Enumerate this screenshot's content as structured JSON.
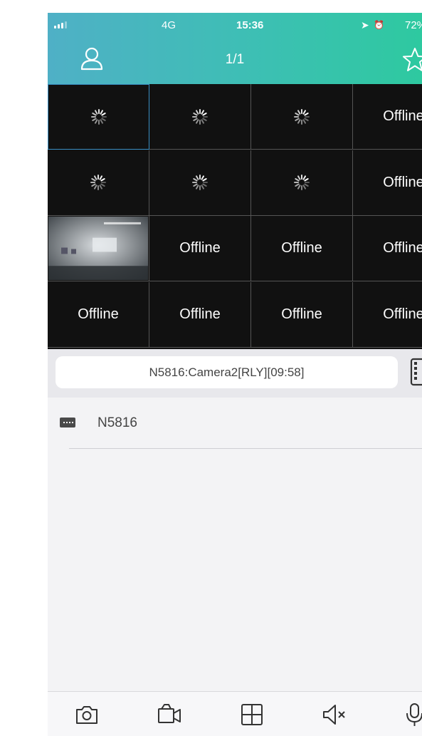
{
  "status_bar": {
    "network": "4G",
    "time": "15:36",
    "battery": "72%"
  },
  "header": {
    "page_indicator": "1/1",
    "icons": [
      "user-icon",
      "star-icon"
    ]
  },
  "grid": {
    "rows": [
      [
        "loading",
        "loading",
        "loading",
        "Offline"
      ],
      [
        "loading",
        "loading",
        "loading",
        "Offline"
      ],
      [
        "video",
        "Offline",
        "Offline",
        "Offline"
      ],
      [
        "Offline",
        "Offline",
        "Offline",
        "Offline"
      ]
    ],
    "selected_cell": [
      0,
      0
    ]
  },
  "channel_bar": {
    "current_channel": "N5816:Camera2[RLY][09:58]",
    "icon": "film-icon"
  },
  "device_list": {
    "devices": [
      {
        "name": "N5816",
        "icon": "nvr-icon"
      }
    ]
  },
  "toolbar": {
    "buttons": [
      "camera-icon",
      "video-record-icon",
      "grid-layout-icon",
      "speaker-mute-icon",
      "microphone-icon"
    ]
  },
  "colors": {
    "header_gradient_start": "#4fb0c6",
    "header_gradient_end": "#2ec9a0",
    "grid_background": "#111111",
    "selected_border": "#3a8fc4"
  }
}
